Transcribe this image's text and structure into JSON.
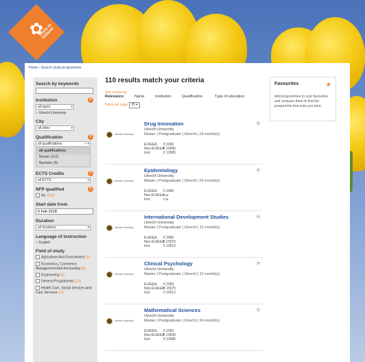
{
  "logo": {
    "text": "study in holland",
    "icon": "tulip-icon"
  },
  "breadcrumb": {
    "home": "Home",
    "separator": "›",
    "current": "Search study programmes"
  },
  "sidebar": {
    "keywords_label": "Search by keywords",
    "keywords_value": "",
    "institution_label": "Institution",
    "institution_select": "all types",
    "institution_chip": "Utrecht University",
    "city_label": "City",
    "city_select": "all cities",
    "qualification_label": "Qualification",
    "qualification_select": "all qualifications",
    "qualification_options": [
      "all qualifications",
      "Master (101)",
      "Bachelor (9)"
    ],
    "ects_label": "ECTS Credits",
    "ects_select": "all ECTS",
    "nfp_label": "NFP qualified",
    "nfp_option": "No",
    "nfp_count": "(110)",
    "start_label": "Start date from",
    "start_value": "6 Feb 2018",
    "duration_label": "Duration",
    "duration_select": "all durations",
    "language_label": "Language of instruction",
    "language_chip": "English",
    "field_label": "Field of study",
    "fields": [
      {
        "name": "Agriculture And Environment",
        "count": "(3)"
      },
      {
        "name": "Economics, Commerce, Management And Accounting",
        "count": "(8)"
      },
      {
        "name": "Engineering",
        "count": "(4)"
      },
      {
        "name": "General Programmes",
        "count": "(13)"
      },
      {
        "name": "Health Care, Social Services And Care Services",
        "count": "(11)"
      }
    ],
    "help_glyph": "?",
    "remove_glyph": "×"
  },
  "main": {
    "results_title": "110 results match your criteria",
    "sort_label": "Sort results by",
    "sort_active": "Relevance",
    "sort_options": [
      "Name",
      "Institution",
      "Qualification",
      "Type of education"
    ],
    "perpage_label": "Items per page",
    "perpage_value": "25"
  },
  "results": [
    {
      "title": "Drug Innovation",
      "university": "Utrecht University",
      "meta": "Master | Postgraduate | Utrecht | 24 month(s)",
      "logo_text": "Utrecht University",
      "fees": [
        [
          "EU/EEA:",
          "€ 2060"
        ],
        [
          "Non-EU/EEA:",
          "€ 19690"
        ],
        [
          "Inst:",
          "€ 12585"
        ]
      ]
    },
    {
      "title": "Epidemiology",
      "university": "Utrecht University",
      "meta": "Master | Postgraduate | Utrecht | 24 month(s)",
      "logo_text": "Utrecht University",
      "fees": [
        [
          "EU/EEA:",
          "€ 2060"
        ],
        [
          "Non-EU/EEA:",
          "n.a."
        ],
        [
          "Inst:",
          "n.a."
        ]
      ]
    },
    {
      "title": "International Development Studies",
      "university": "Utrecht University",
      "meta": "Master | Postgraduate | Utrecht | 12 month(s)",
      "logo_text": "Utrecht University",
      "fees": [
        [
          "EU/EEA:",
          "€ 2060"
        ],
        [
          "Non-EU/EEA:",
          "€ 15575"
        ],
        [
          "Inst:",
          "€ 10512"
        ]
      ]
    },
    {
      "title": "Clinical Psychology",
      "university": "Utrecht University",
      "meta": "Master | Postgraduate | Utrecht | 12 month(s)",
      "logo_text": "Utrecht University",
      "fees": [
        [
          "EU/EEA:",
          "€ 2060"
        ],
        [
          "Non-EU/EEA:",
          "€ 15575"
        ],
        [
          "Inst:",
          "€ 10512"
        ]
      ]
    },
    {
      "title": "Mathematical Sciences",
      "university": "Utrecht University",
      "meta": "Master | Postgraduate | Utrecht | 24 month(s)",
      "logo_text": "Utrecht University",
      "fees": [
        [
          "EU/EEA:",
          "€ 2060"
        ],
        [
          "Non-EU/EEA:",
          "€ 19690"
        ],
        [
          "Inst:",
          "€ 12585"
        ]
      ]
    }
  ],
  "favourites": {
    "title": "Favourites",
    "text": "Add programmes to your favourites and compare them to find the programme that suits you best."
  },
  "colors": {
    "accent": "#ee7f2d",
    "link": "#1f4e9c",
    "sidebar_bg": "#e6e6e6",
    "sky": "#5a7fbf",
    "tulip": "#f4c913"
  }
}
